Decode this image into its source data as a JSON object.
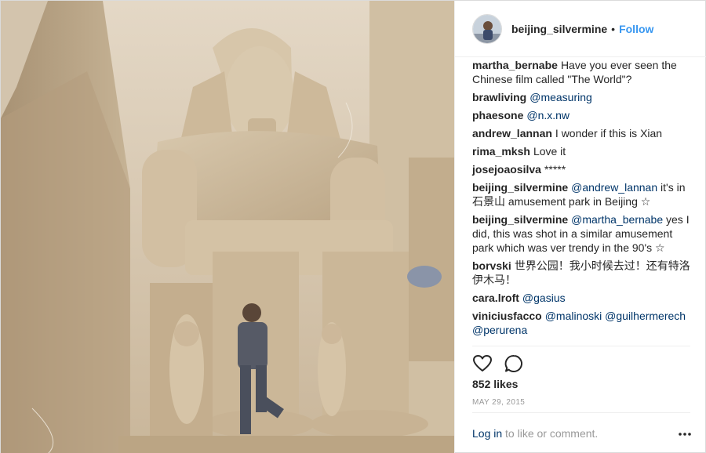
{
  "header": {
    "username": "beijing_silvermine",
    "dot": "•",
    "follow_label": "Follow"
  },
  "comments": [
    {
      "user": "martha_bernabe",
      "text": "Have you ever seen the Chinese film called \"The World\"?",
      "mention": "",
      "after": ""
    },
    {
      "user": "brawliving",
      "text": "",
      "mention": "@measuring",
      "after": ""
    },
    {
      "user": "phaesone",
      "text": "",
      "mention": "@n.x.nw",
      "after": ""
    },
    {
      "user": "andrew_lannan",
      "text": "I wonder if this is Xian",
      "mention": "",
      "after": ""
    },
    {
      "user": "rima_mksh",
      "text": "Love it",
      "mention": "",
      "after": ""
    },
    {
      "user": "josejoaosilva",
      "text": "*****",
      "mention": "",
      "after": ""
    },
    {
      "user": "beijing_silvermine",
      "text": "",
      "mention": "@andrew_lannan",
      "after": "it's in 石景山 amusement park in Beijing ☆"
    },
    {
      "user": "beijing_silvermine",
      "text": "",
      "mention": "@martha_bernabe",
      "after": "yes I did, this was shot in a similar amusement park which was ver trendy in the 90's ☆"
    },
    {
      "user": "borvski",
      "text": "世界公园！我小时候去过！还有特洛伊木马！",
      "mention": "",
      "after": ""
    },
    {
      "user": "cara.lroft",
      "text": "",
      "mention": "@gasius",
      "after": ""
    },
    {
      "user": "viniciusfacco",
      "text": "",
      "mention": "@malinoski @guilhermerech @perurena",
      "after": ""
    }
  ],
  "likes": "852 likes",
  "date": "MAY 29, 2015",
  "login": {
    "link": "Log in",
    "rest": " to like or comment."
  },
  "icons": {
    "like": "heart-icon",
    "comment": "comment-icon",
    "more": "more-options-icon"
  },
  "colors": {
    "link": "#3897f0",
    "mention": "#003569",
    "muted": "#999999",
    "text": "#262626"
  }
}
